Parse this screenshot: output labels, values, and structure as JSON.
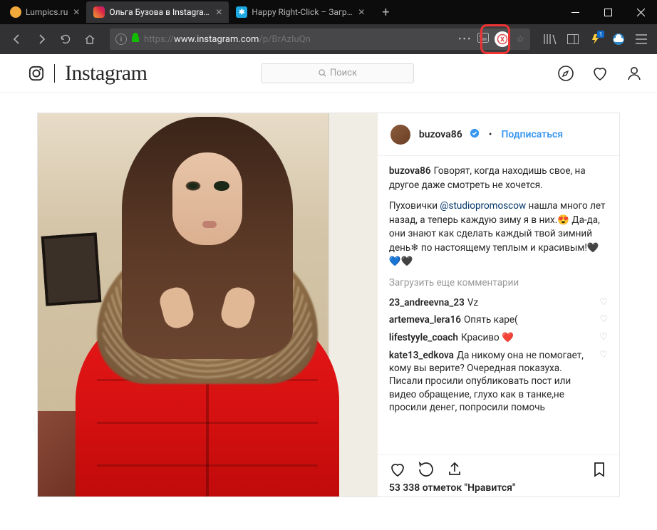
{
  "browser": {
    "tabs": [
      {
        "label": "Lumpics.ru",
        "icon_color": "#f2a93b"
      },
      {
        "label": "Ольга Бузова в Instagram: «Г",
        "icon_color": "#fff",
        "active": true
      },
      {
        "label": "Happy Right-Click – Загрузи",
        "icon_color": "#1ca8e3"
      }
    ],
    "url_prefix": "https://",
    "url_host": "www.instagram.com",
    "url_path": "/p/BrAzIuQn"
  },
  "instagram": {
    "wordmark": "Instagram",
    "search_placeholder": "Поиск"
  },
  "post": {
    "username": "buzova86",
    "follow_label": "Подписаться",
    "caption_user": "buzova86",
    "caption_1": "Говорят, когда находишь свое, на другое даже смотреть не хочется.",
    "caption_2a": "Пуховички ",
    "caption_mention": "@studiopromoscow",
    "caption_2b": " нашла много лет назад, а теперь каждую зиму я в них.😍 Да-да, они знают как сделать каждый твой зимний день❄ по настоящему теплым и красивым!🖤💙🖤",
    "load_more": "Загрузить еще комментарии",
    "comments": [
      {
        "user": "23_andreevna_23",
        "text": "Vz"
      },
      {
        "user": "artemeva_lera16",
        "text": "Опять каре("
      },
      {
        "user": "lifestyyle_coach",
        "text": "Красиво ❤️"
      },
      {
        "user": "kate13_edkova",
        "text": "Да никому она не помогает, кому вы верите? Очередная показуха. Писали просили опубликовать пост или видео обращение, глухо как в танке,не просили денег, попросили помочь"
      }
    ],
    "likes_text": "53 338 отметок \"Нравится\""
  }
}
